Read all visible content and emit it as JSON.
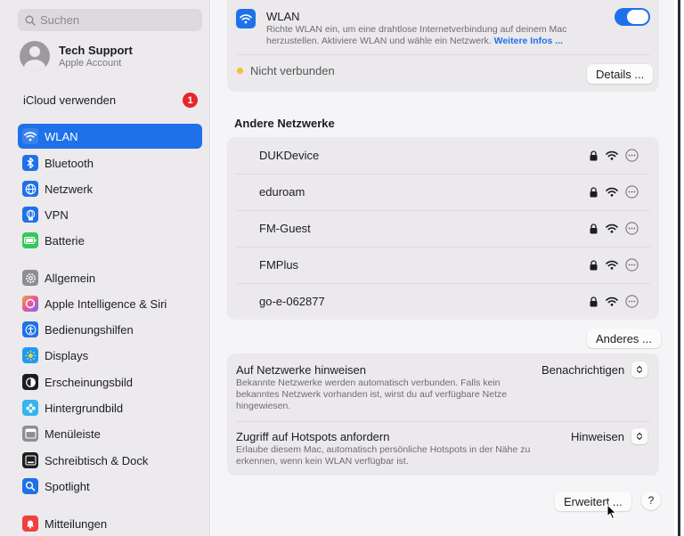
{
  "sidebar": {
    "search_placeholder": "Suchen",
    "account": {
      "name": "Tech Support",
      "subtitle": "Apple Account"
    },
    "icloud": {
      "label": "iCloud verwenden",
      "badge": "1"
    },
    "items": [
      {
        "label": "WLAN",
        "icon": "wifi-icon",
        "color": "#1e71e8",
        "active": true
      },
      {
        "label": "Bluetooth",
        "icon": "bluetooth-icon",
        "color": "#1e71e8"
      },
      {
        "label": "Netzwerk",
        "icon": "globe-icon",
        "color": "#1e71e8"
      },
      {
        "label": "VPN",
        "icon": "vpn-icon",
        "color": "#1e71e8"
      },
      {
        "label": "Batterie",
        "icon": "battery-icon",
        "color": "#34c759"
      },
      {
        "label": "Allgemein",
        "icon": "gear-icon",
        "color": "#8e8e93"
      },
      {
        "label": "Apple Intelligence & Siri",
        "icon": "siri-icon",
        "color": "#c86dd7"
      },
      {
        "label": "Bedienungshilfen",
        "icon": "accessibility-icon",
        "color": "#1e71e8"
      },
      {
        "label": "Displays",
        "icon": "display-brightness-icon",
        "color": "#1e9bf0"
      },
      {
        "label": "Erscheinungsbild",
        "icon": "appearance-icon",
        "color": "#1d1d1f"
      },
      {
        "label": "Hintergrundbild",
        "icon": "wallpaper-icon",
        "color": "#35b5ec"
      },
      {
        "label": "Menüleiste",
        "icon": "menubar-icon",
        "color": "#8e8e93"
      },
      {
        "label": "Schreibtisch & Dock",
        "icon": "dock-icon",
        "color": "#1d1d1f"
      },
      {
        "label": "Spotlight",
        "icon": "spotlight-search-icon",
        "color": "#1e71e8"
      },
      {
        "label": "Mitteilungen",
        "icon": "notifications-bell-icon",
        "color": "#ef4040"
      }
    ]
  },
  "wlan": {
    "title": "WLAN",
    "description": "Richte WLAN ein, um eine drahtlose Internetverbindung auf deinem Mac herzustellen. Aktiviere WLAN und wähle ein Netzwerk.",
    "more_link": "Weitere Infos ...",
    "enabled": true,
    "status": "Nicht verbunden",
    "details_button": "Details ..."
  },
  "networks": {
    "title": "Andere Netzwerke",
    "items": [
      {
        "name": "DUKDevice"
      },
      {
        "name": "eduroam"
      },
      {
        "name": "FM-Guest"
      },
      {
        "name": "FMPlus"
      },
      {
        "name": "go-e-062877"
      }
    ],
    "other_button": "Anderes ..."
  },
  "settings": {
    "ask_join": {
      "title": "Auf Netzwerke hinweisen",
      "description": "Bekannte Netzwerke werden automatisch verbunden. Falls kein bekanntes Netzwerk vorhanden ist, wirst du auf verfügbare Netze hingewiesen.",
      "value": "Benachrichtigen"
    },
    "hotspots": {
      "title": "Zugriff auf Hotspots anfordern",
      "description": "Erlaube diesem Mac, automatisch persönliche Hotspots in der Nähe zu erkennen, wenn kein WLAN verfügbar ist.",
      "value": "Hinweisen"
    }
  },
  "footer": {
    "advanced_button": "Erweitert ...",
    "help_button": "?"
  }
}
